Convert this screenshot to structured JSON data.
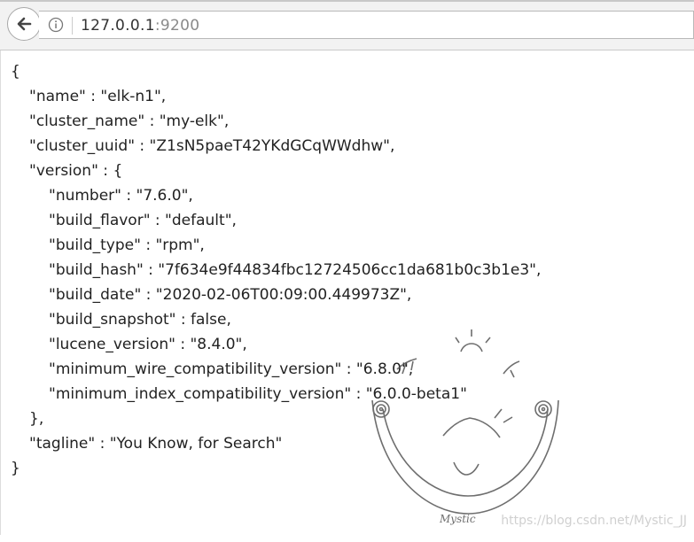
{
  "browser": {
    "url_host": "127.0.0.1",
    "url_port": ":9200"
  },
  "json_lines": [
    "{",
    "\"name\" : \"elk-n1\",",
    "\"cluster_name\" : \"my-elk\",",
    "\"cluster_uuid\" : \"Z1sN5paeT42YKdGCqWWdhw\",",
    "\"version\" : {",
    "\"number\" : \"7.6.0\",",
    "\"build_flavor\" : \"default\",",
    "\"build_type\" : \"rpm\",",
    "\"build_hash\" : \"7f634e9f44834fbc12724506cc1da681b0c3b1e3\",",
    "\"build_date\" : \"2020-02-06T00:09:00.449973Z\",",
    "\"build_snapshot\" : false,",
    "\"lucene_version\" : \"8.4.0\",",
    "\"minimum_wire_compatibility_version\" : \"6.8.0\",",
    "\"minimum_index_compatibility_version\" : \"6.0.0-beta1\"",
    "},",
    "\"tagline\" : \"You Know, for Search\"",
    "}"
  ],
  "watermark": {
    "signature": "Mystic",
    "site": "https://blog.csdn.net/Mystic_JJ"
  }
}
